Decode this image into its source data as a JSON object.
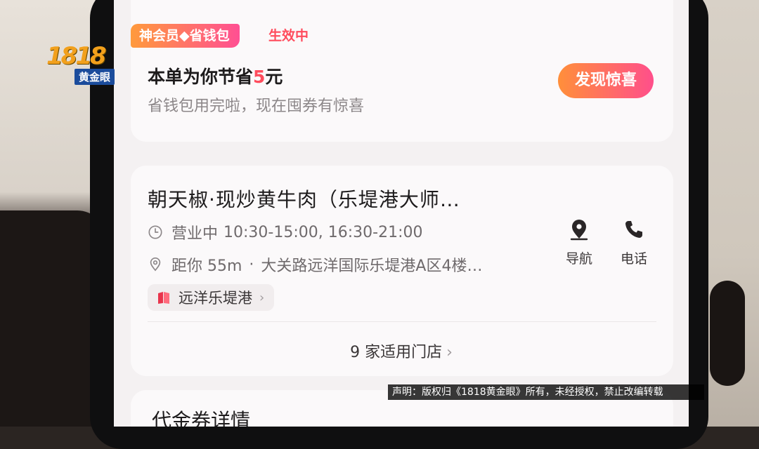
{
  "watermark": {
    "logo_number": "1818",
    "logo_text": "黄金眼",
    "disclaimer": "声明：版权归《1818黄金眼》所有，未经授权，禁止改编转载"
  },
  "promo": {
    "badge": "神会员◆省钱包",
    "status": "生效中",
    "save_prefix": "本单为你节省",
    "save_amount": "5",
    "save_unit": "元",
    "subtitle": "省钱包用完啦，现在囤券有惊喜",
    "button": "发现惊喜"
  },
  "store": {
    "name": "朝天椒·现炒黄牛肉（乐堤港大师…",
    "status": "营业中",
    "hours": "10:30-15:00, 16:30-21:00",
    "distance": "距你 55m",
    "separator": "·",
    "address": "大关路远洋国际乐堤港A区4楼…",
    "nav_label": "导航",
    "call_label": "电话",
    "mall_tag": "远洋乐堤港",
    "stores_link": "9 家适用门店"
  },
  "voucher": {
    "title": "代金券详情"
  },
  "colors": {
    "accent_red": "#ff4c5d",
    "gradient_start": "#ff8f3a",
    "gradient_end": "#ff4f8b"
  }
}
